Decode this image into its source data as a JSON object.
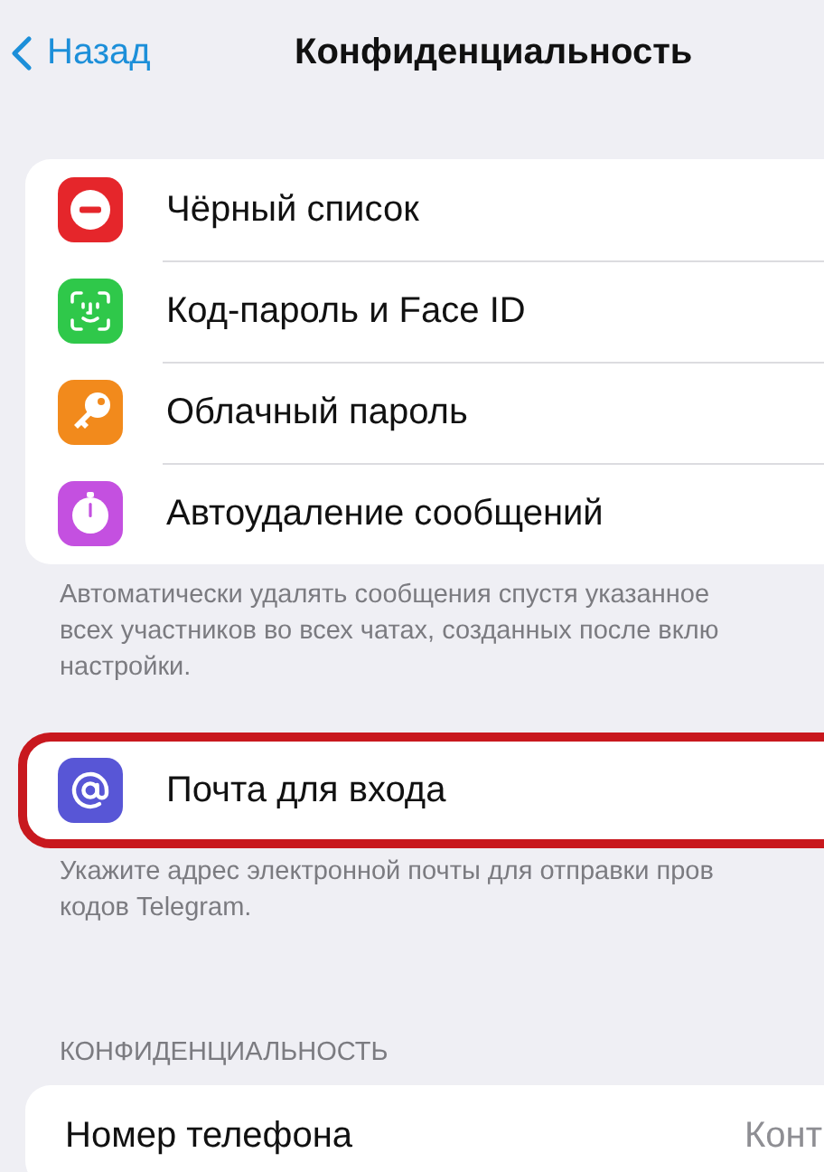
{
  "nav": {
    "back": "Назад",
    "title": "Конфиденциальность"
  },
  "sections": [
    {
      "rows": [
        {
          "kind": "blocked",
          "label": "Чёрный список",
          "highlighted": false
        },
        {
          "kind": "faceid",
          "label": "Код-пароль и Face ID",
          "highlighted": false
        },
        {
          "kind": "key",
          "label": "Облачный пароль",
          "highlighted": false
        },
        {
          "kind": "timer",
          "label": "Автоудаление сообщений",
          "highlighted": false
        }
      ],
      "footer": [
        "Автоматически удалять сообщения спустя указанное",
        "всех участников во всех чатах, созданных после вклю",
        "настройки."
      ]
    },
    {
      "rows": [
        {
          "kind": "email",
          "label": "Почта для входа",
          "highlighted": true
        }
      ],
      "footer": [
        "Укажите адрес электронной почты для отправки пров",
        "кодов Telegram."
      ]
    },
    {
      "header": "КОНФИДЕНЦИАЛЬНОСТЬ",
      "rows": [
        {
          "kind": "plain",
          "label": "Номер телефона",
          "value": "Конт",
          "highlighted": false
        }
      ]
    }
  ]
}
